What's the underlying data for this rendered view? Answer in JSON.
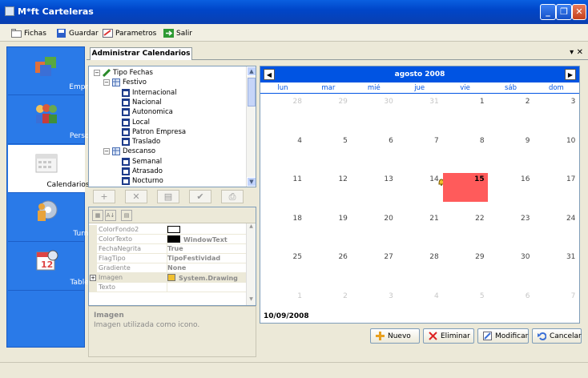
{
  "window": {
    "title": "M*ft Carteleras",
    "minimize": "_",
    "restore": "❐",
    "close": "✕"
  },
  "menu": [
    {
      "label": "Fichas",
      "icon": "folder-icon"
    },
    {
      "label": "Guardar",
      "icon": "save-icon"
    },
    {
      "label": "Parametros",
      "icon": "parameters-icon"
    },
    {
      "label": "Salir",
      "icon": "exit-icon"
    }
  ],
  "nav": [
    {
      "label": "Empresa",
      "icon": "company-icon",
      "selected": false
    },
    {
      "label": "Personal",
      "icon": "people-icon",
      "selected": false
    },
    {
      "label": "Calendarios y Fechas",
      "icon": "calendar-icon",
      "selected": true
    },
    {
      "label": "Turnos",
      "icon": "shifts-icon",
      "selected": false
    },
    {
      "label": "Tableros",
      "icon": "boards-icon",
      "selected": false
    }
  ],
  "tab": {
    "label": "Administrar Calendarios",
    "pin": "▾ ✕"
  },
  "tree": [
    {
      "label": "Tipo Fechas",
      "level": 0,
      "expander": "−"
    },
    {
      "label": "Festivo",
      "level": 1,
      "expander": "−"
    },
    {
      "label": "Internacional",
      "level": 2,
      "expander": ""
    },
    {
      "label": "Nacional",
      "level": 2,
      "expander": ""
    },
    {
      "label": "Autonomica",
      "level": 2,
      "expander": ""
    },
    {
      "label": "Local",
      "level": 2,
      "expander": ""
    },
    {
      "label": "Patron Empresa",
      "level": 2,
      "expander": ""
    },
    {
      "label": "Traslado",
      "level": 2,
      "expander": ""
    },
    {
      "label": "Descanso",
      "level": 1,
      "expander": "−"
    },
    {
      "label": "Semanal",
      "level": 2,
      "expander": ""
    },
    {
      "label": "Atrasado",
      "level": 2,
      "expander": ""
    },
    {
      "label": "Nocturno",
      "level": 2,
      "expander": ""
    }
  ],
  "tree_toolbar": [
    "+",
    "✕",
    "▤",
    "✔",
    "⎙"
  ],
  "properties": {
    "toolbar": [
      "▦",
      "A↓",
      "▤"
    ],
    "rows": [
      {
        "name": "ColorFondo2",
        "value": "",
        "swatch": "#ffffff"
      },
      {
        "name": "ColorTexto",
        "value": "WindowText",
        "swatch": "#000000"
      },
      {
        "name": "FechaNegrita",
        "value": "True"
      },
      {
        "name": "FlagTipo",
        "value": "TipoFestividad"
      },
      {
        "name": "Gradiente",
        "value": "None"
      },
      {
        "name": "Imagen",
        "value": "System.Drawing",
        "expander": "+"
      },
      {
        "name": "Texto",
        "value": ""
      }
    ],
    "description_title": "Imagen",
    "description_text": "Imagen utilizada como icono."
  },
  "calendar": {
    "month_title": "agosto 2008",
    "prev": "◀",
    "next": "▶",
    "weekdays": [
      "lun",
      "mar",
      "mié",
      "jue",
      "vie",
      "sáb",
      "dom"
    ],
    "weeks": [
      [
        "28",
        "29",
        "30",
        "31",
        "1",
        "2",
        "3"
      ],
      [
        "4",
        "5",
        "6",
        "7",
        "8",
        "9",
        "10"
      ],
      [
        "11",
        "12",
        "13",
        "14",
        "15",
        "16",
        "17"
      ],
      [
        "18",
        "19",
        "20",
        "21",
        "22",
        "23",
        "24"
      ],
      [
        "25",
        "26",
        "27",
        "28",
        "29",
        "30",
        "31"
      ],
      [
        "1",
        "2",
        "3",
        "4",
        "5",
        "6",
        "7"
      ]
    ],
    "other_month": [
      [
        true,
        true,
        true,
        true,
        false,
        false,
        false
      ],
      [
        false,
        false,
        false,
        false,
        false,
        false,
        false
      ],
      [
        false,
        false,
        false,
        false,
        false,
        false,
        false
      ],
      [
        false,
        false,
        false,
        false,
        false,
        false,
        false
      ],
      [
        false,
        false,
        false,
        false,
        false,
        false,
        false
      ],
      [
        true,
        true,
        true,
        true,
        true,
        true,
        true
      ]
    ],
    "highlight_color": "#ff5b5b",
    "footer_date": "10/09/2008"
  },
  "actions": [
    {
      "label": "Nuevo",
      "icon": "add-icon"
    },
    {
      "label": "Eliminar",
      "icon": "delete-icon"
    },
    {
      "label": "Modificar",
      "icon": "edit-icon"
    },
    {
      "label": "Cancelar",
      "icon": "undo-icon"
    }
  ]
}
